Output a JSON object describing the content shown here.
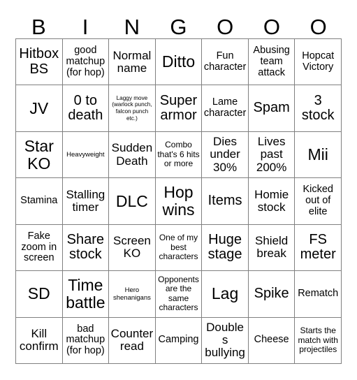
{
  "card": {
    "title_letters": [
      "B",
      "I",
      "N",
      "G",
      "O",
      "O",
      "O"
    ],
    "columns": 7,
    "rows": 7,
    "grid_line_color": "#808080",
    "background_color": "#ffffff",
    "text_color": "#000000",
    "cells": [
      [
        {
          "text": "Hitbox BS",
          "size": "xl"
        },
        {
          "text": "good matchup (for hop)",
          "size": "md"
        },
        {
          "text": "Normal name",
          "size": "lg"
        },
        {
          "text": "Ditto",
          "size": "xxl"
        },
        {
          "text": "Fun character",
          "size": "md"
        },
        {
          "text": "Abusing team attack",
          "size": "md"
        },
        {
          "text": "Hopcat Victory",
          "size": "md"
        }
      ],
      [
        {
          "text": "JV",
          "size": "xxl"
        },
        {
          "text": "0 to death",
          "size": "xl"
        },
        {
          "text": "Laggy move (warlock punch, falcon punch etc.)",
          "size": "xxs"
        },
        {
          "text": "Super armor",
          "size": "xl"
        },
        {
          "text": "Lame character",
          "size": "md"
        },
        {
          "text": "Spam",
          "size": "xl"
        },
        {
          "text": "3 stock",
          "size": "xl"
        }
      ],
      [
        {
          "text": "Star KO",
          "size": "xxl"
        },
        {
          "text": "Heavyweight",
          "size": "xs"
        },
        {
          "text": "Sudden Death",
          "size": "lg"
        },
        {
          "text": "Combo that's 6 hits or more",
          "size": "sm"
        },
        {
          "text": "Dies under 30%",
          "size": "lg"
        },
        {
          "text": "Lives past 200%",
          "size": "lg"
        },
        {
          "text": "Mii",
          "size": "xxl"
        }
      ],
      [
        {
          "text": "Stamina",
          "size": "md"
        },
        {
          "text": "Stalling timer",
          "size": "lg"
        },
        {
          "text": "DLC",
          "size": "xxl"
        },
        {
          "text": "Hop wins",
          "size": "xxl"
        },
        {
          "text": "Items",
          "size": "xl"
        },
        {
          "text": "Homie stock",
          "size": "lg"
        },
        {
          "text": "Kicked out of elite",
          "size": "md"
        }
      ],
      [
        {
          "text": "Fake zoom in screen",
          "size": "md"
        },
        {
          "text": "Share stock",
          "size": "xl"
        },
        {
          "text": "Screen KO",
          "size": "lg"
        },
        {
          "text": "One of my best characters",
          "size": "sm"
        },
        {
          "text": "Huge stage",
          "size": "xl"
        },
        {
          "text": "Shield break",
          "size": "lg"
        },
        {
          "text": "FS meter",
          "size": "xl"
        }
      ],
      [
        {
          "text": "SD",
          "size": "xxl"
        },
        {
          "text": "Time battle",
          "size": "xxl"
        },
        {
          "text": "Hero shenanigans",
          "size": "xs"
        },
        {
          "text": "Opponents are the same characters",
          "size": "sm"
        },
        {
          "text": "Lag",
          "size": "xxl"
        },
        {
          "text": "Spike",
          "size": "xl"
        },
        {
          "text": "Rematch",
          "size": "md"
        }
      ],
      [
        {
          "text": "Kill confirm",
          "size": "lg"
        },
        {
          "text": "bad matchup (for hop)",
          "size": "md"
        },
        {
          "text": "Counter read",
          "size": "lg"
        },
        {
          "text": "Camping",
          "size": "md"
        },
        {
          "text": "Doubles bullying",
          "size": "lg"
        },
        {
          "text": "Cheese",
          "size": "md"
        },
        {
          "text": "Starts the match with projectiles",
          "size": "sm"
        }
      ]
    ]
  }
}
